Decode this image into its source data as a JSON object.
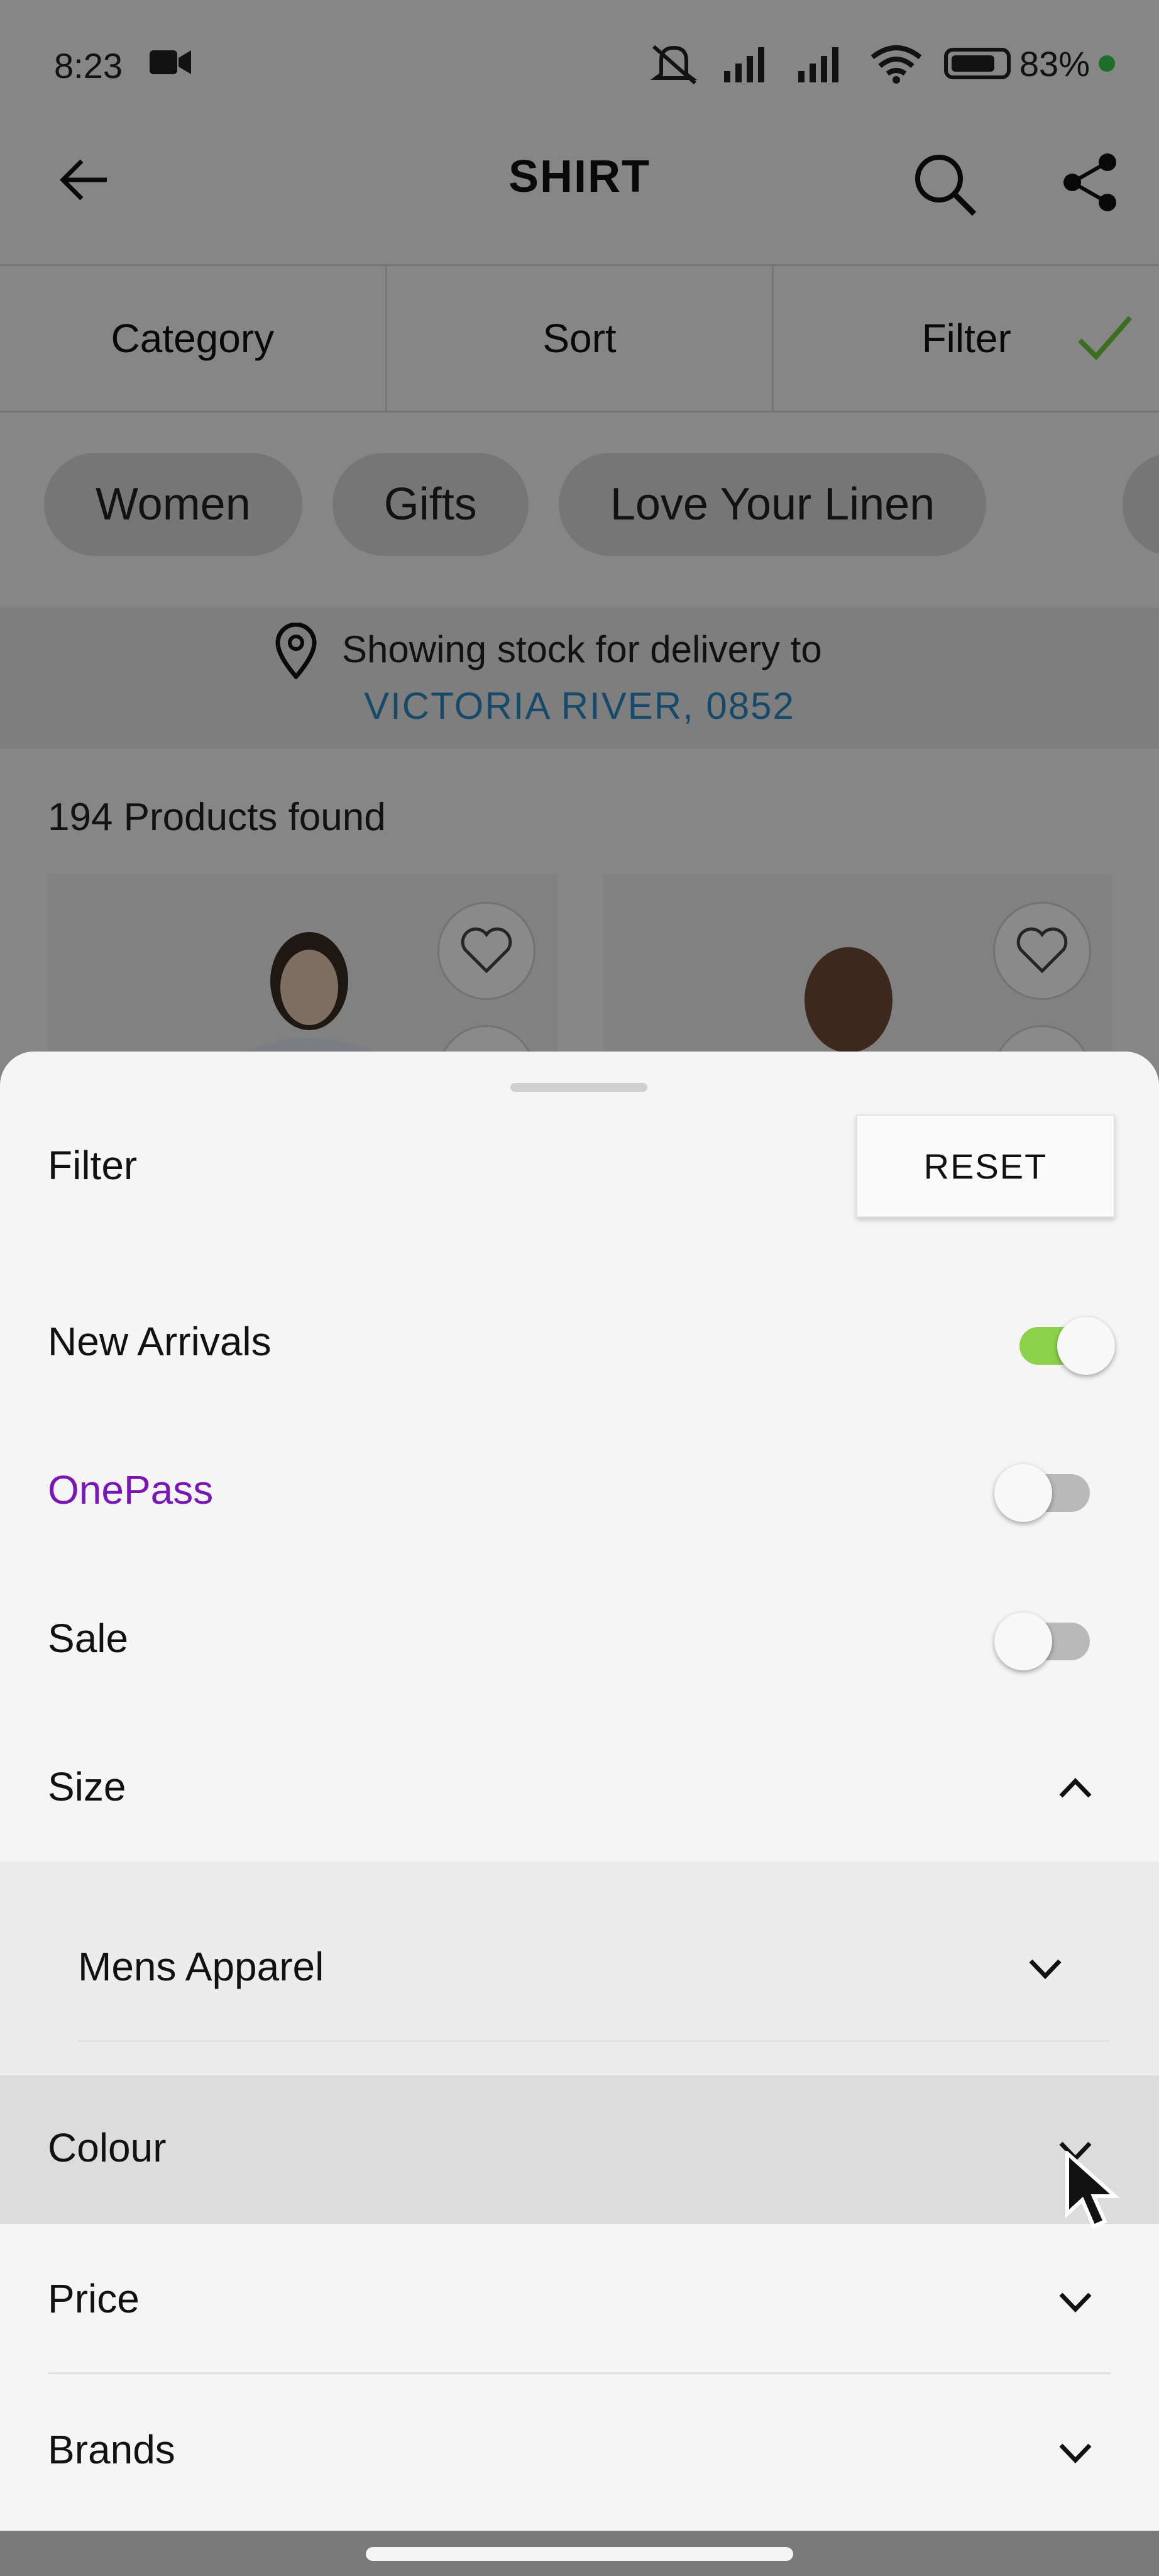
{
  "status_bar": {
    "time": "8:23",
    "battery": "83%",
    "icons": [
      "video-camera-icon",
      "mute-icon",
      "signal-icon",
      "signal-icon",
      "wifi-icon",
      "battery-icon"
    ]
  },
  "app_bar": {
    "title": "SHIRT",
    "icons": [
      "back-arrow-icon",
      "search-icon",
      "share-icon"
    ]
  },
  "tabs": [
    {
      "label": "Category"
    },
    {
      "label": "Sort"
    },
    {
      "label": "Filter",
      "active_check": true
    }
  ],
  "chips": [
    {
      "label": "Women"
    },
    {
      "label": "Gifts"
    },
    {
      "label": "Love Your Linen"
    }
  ],
  "delivery": {
    "text": "Showing stock for delivery to",
    "location": "VICTORIA RIVER, 0852",
    "location_color": "#2a87c2"
  },
  "products": {
    "count_text": "194 Products found"
  },
  "sheet": {
    "title": "Filter",
    "reset_label": "RESET",
    "toggles": [
      {
        "label": "New Arrivals",
        "on": true
      },
      {
        "label": "OnePass",
        "on": false,
        "color": "#7a16b8"
      },
      {
        "label": "Sale",
        "on": false
      }
    ],
    "size": {
      "label": "Size",
      "expanded": true,
      "sub_item": "Mens Apparel"
    },
    "sections": [
      {
        "label": "Colour"
      },
      {
        "label": "Price"
      },
      {
        "label": "Brands"
      }
    ],
    "toggle_on_color": "#8bd14a"
  }
}
